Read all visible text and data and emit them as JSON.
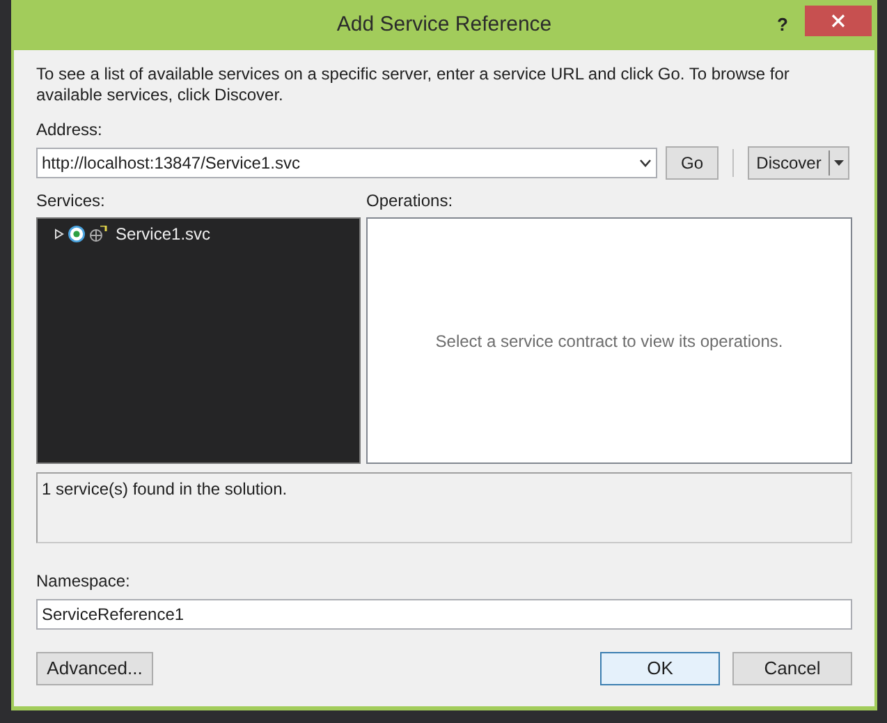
{
  "window": {
    "title": "Add Service Reference",
    "help": "?"
  },
  "instructions": "To see a list of available services on a specific server, enter a service URL and click Go. To browse for available services, click Discover.",
  "address": {
    "label": "Address:",
    "value": "http://localhost:13847/Service1.svc"
  },
  "go_button": "Go",
  "discover_button": "Discover",
  "services": {
    "label": "Services:",
    "items": [
      {
        "label": "Service1.svc",
        "expanded": false,
        "selected": false
      }
    ]
  },
  "operations": {
    "label": "Operations:",
    "empty_message": "Select a service contract to view its operations."
  },
  "status": "1 service(s) found in the solution.",
  "namespace": {
    "label": "Namespace:",
    "value": "ServiceReference1"
  },
  "buttons": [
    {
      "label": "Advanced...",
      "kind": "plain"
    },
    {
      "label": "OK",
      "kind": "default"
    },
    {
      "label": "Cancel",
      "kind": "plain"
    }
  ]
}
